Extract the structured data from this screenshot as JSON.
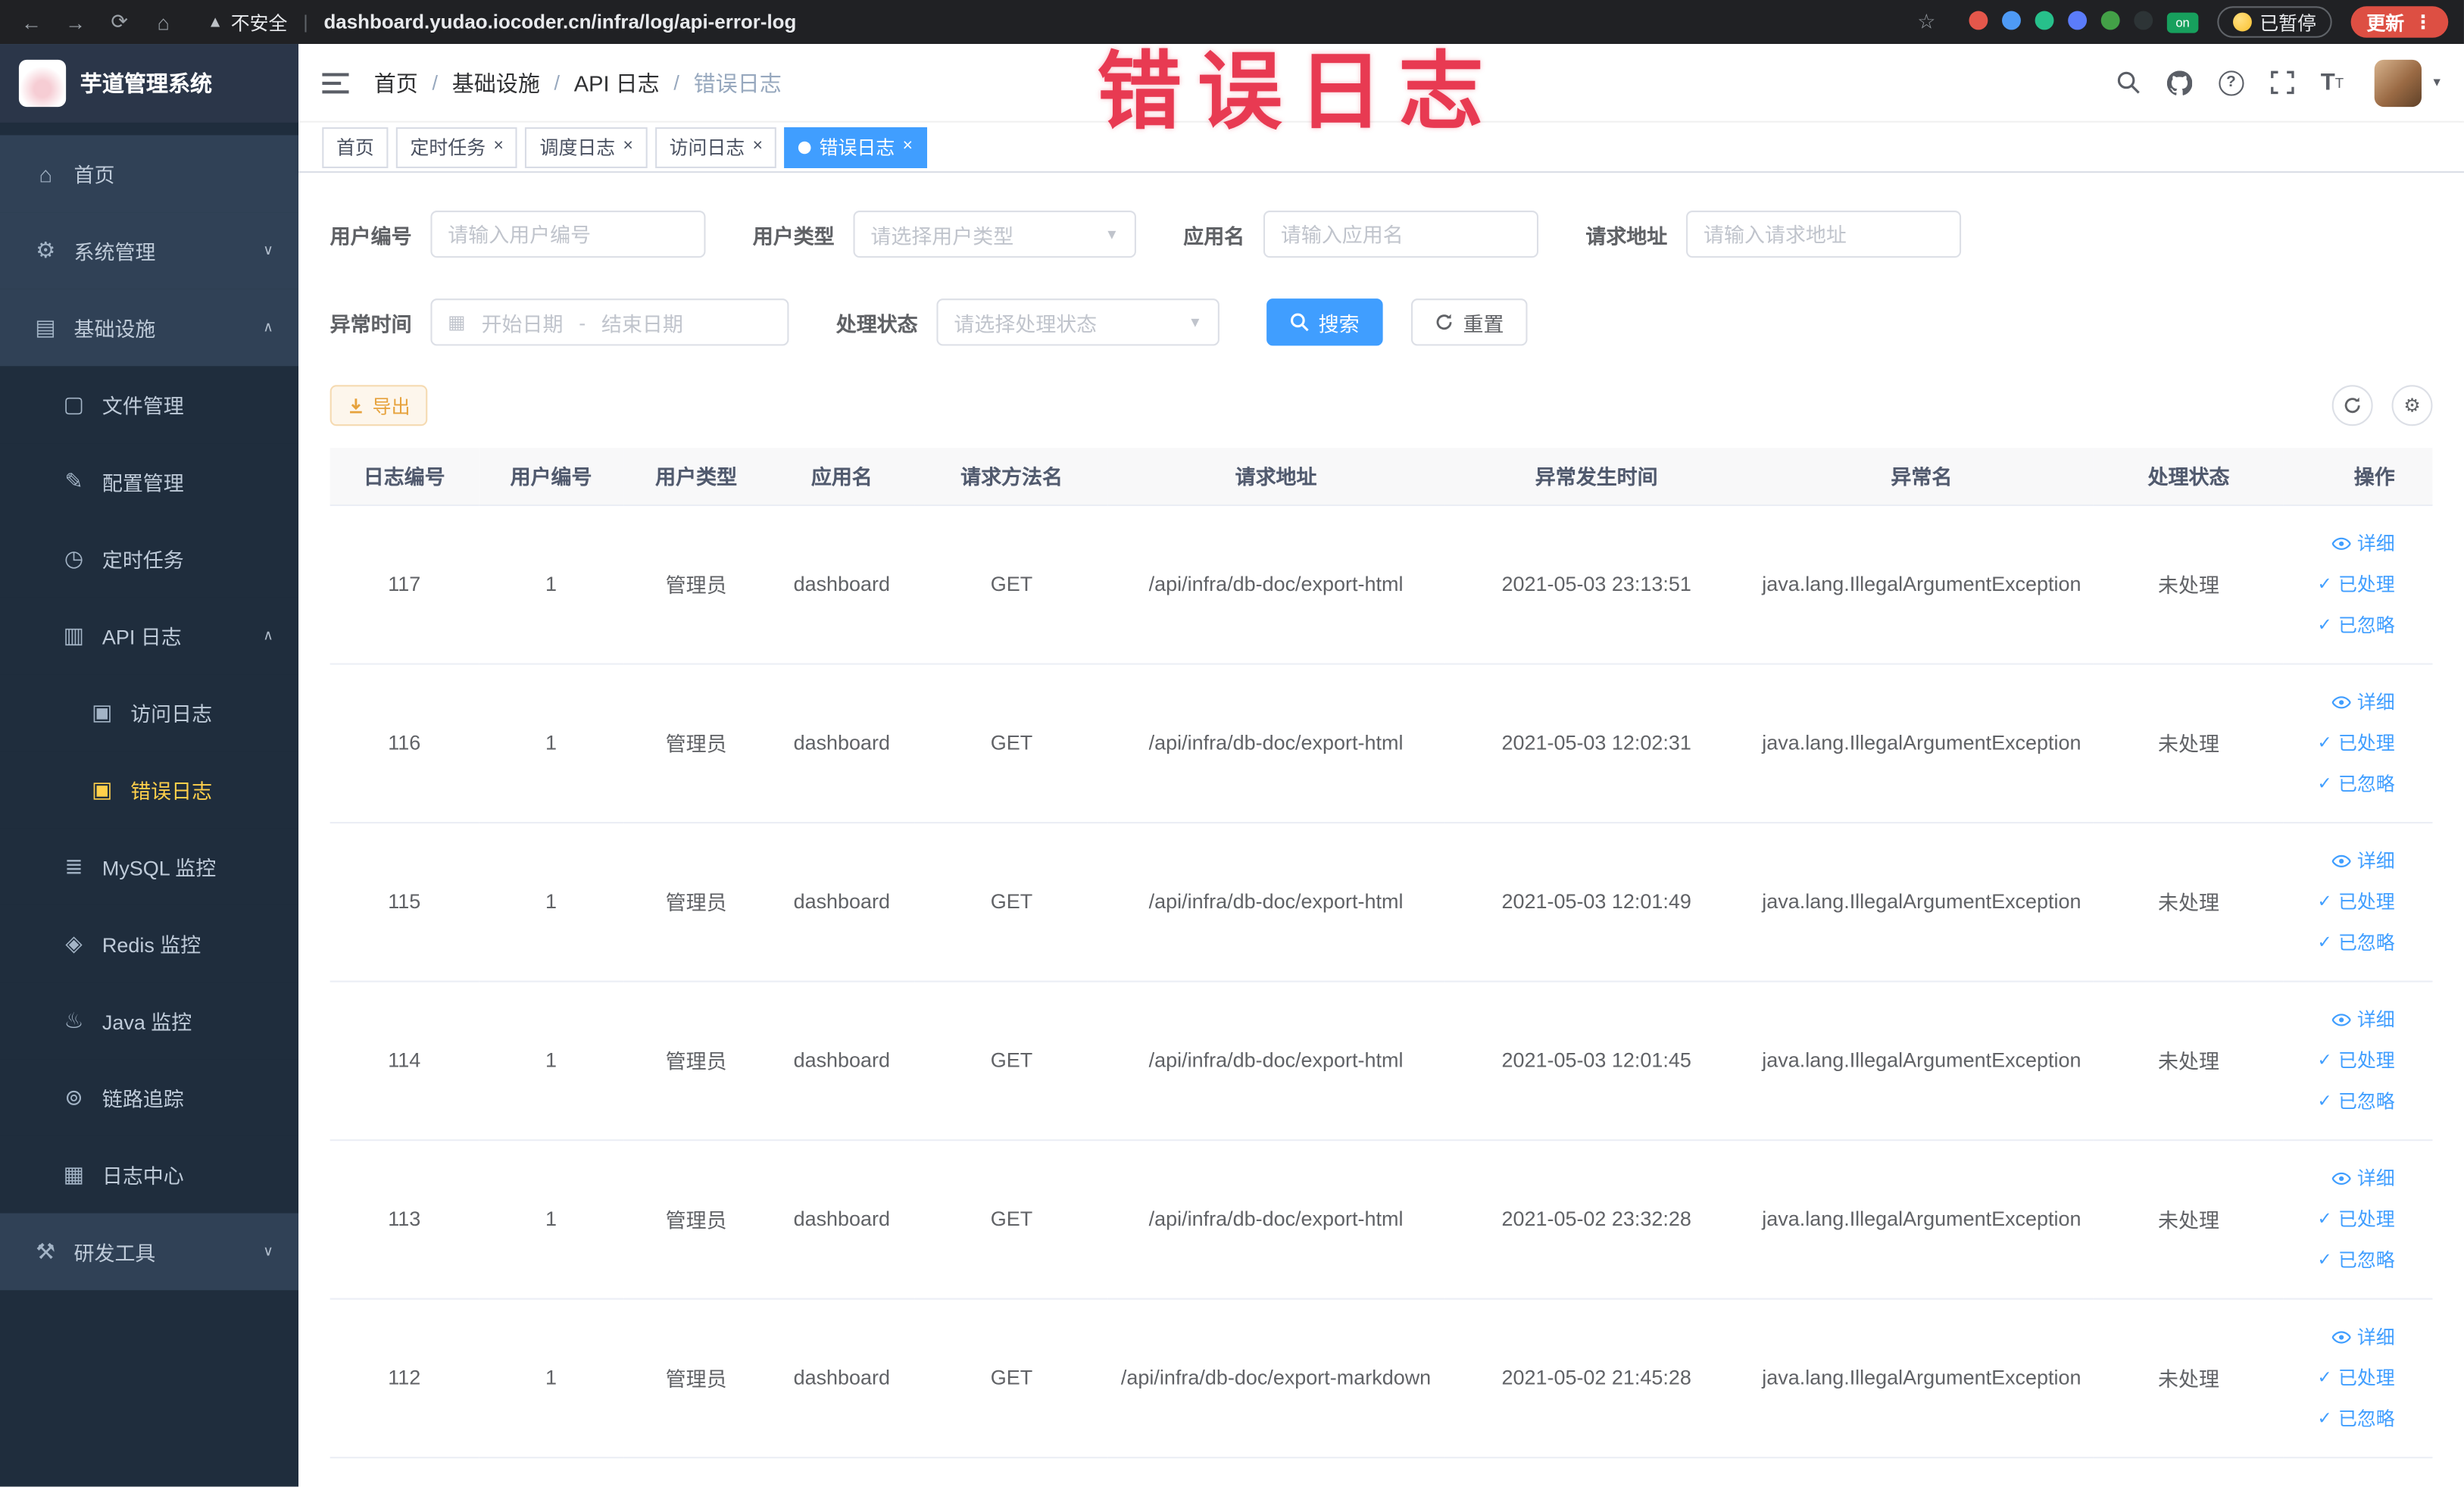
{
  "annotation": {
    "text": "错误日志"
  },
  "browser": {
    "security_text": "不安全",
    "url": "dashboard.yudao.iocoder.cn/infra/log/api-error-log",
    "paused_badge": "已暂停",
    "update_label": "更新",
    "extension_colors": [
      "#e4574b",
      "#4e9af5",
      "#27c08b",
      "#5b7cfa",
      "#43a047",
      "#2d3436"
    ]
  },
  "sidebar": {
    "logo_title": "芋道管理系统",
    "menu": [
      {
        "key": "home",
        "label": "首页",
        "level": 1,
        "icon": "home"
      },
      {
        "key": "system",
        "label": "系统管理",
        "level": 1,
        "icon": "gear",
        "arrow": "down"
      },
      {
        "key": "infra",
        "label": "基础设施",
        "level": 1,
        "icon": "monitor",
        "arrow": "up"
      },
      {
        "key": "file",
        "label": "文件管理",
        "level": 2,
        "icon": "folder"
      },
      {
        "key": "config",
        "label": "配置管理",
        "level": 2,
        "icon": "edit"
      },
      {
        "key": "job",
        "label": "定时任务",
        "level": 2,
        "icon": "timer"
      },
      {
        "key": "api-log",
        "label": "API 日志",
        "level": 2,
        "icon": "log",
        "arrow": "up"
      },
      {
        "key": "access-log",
        "label": "访问日志",
        "level": 3,
        "icon": "doc"
      },
      {
        "key": "error-log",
        "label": "错误日志",
        "level": 3,
        "icon": "doc",
        "active": true
      },
      {
        "key": "mysql",
        "label": "MySQL 监控",
        "level": 2,
        "icon": "database"
      },
      {
        "key": "redis",
        "label": "Redis 监控",
        "level": 2,
        "icon": "redis"
      },
      {
        "key": "java",
        "label": "Java 监控",
        "level": 2,
        "icon": "coffee"
      },
      {
        "key": "trace",
        "label": "链路追踪",
        "level": 2,
        "icon": "trace"
      },
      {
        "key": "log-center",
        "label": "日志中心",
        "level": 2,
        "icon": "chart"
      },
      {
        "key": "dev-tools",
        "label": "研发工具",
        "level": 1,
        "icon": "tools",
        "arrow": "down"
      }
    ]
  },
  "header": {
    "breadcrumb": [
      "首页",
      "基础设施",
      "API 日志",
      "错误日志"
    ]
  },
  "tabs": [
    {
      "label": "首页",
      "closable": false,
      "active": false
    },
    {
      "label": "定时任务",
      "closable": true,
      "active": false
    },
    {
      "label": "调度日志",
      "closable": true,
      "active": false
    },
    {
      "label": "访问日志",
      "closable": true,
      "active": false
    },
    {
      "label": "错误日志",
      "closable": true,
      "active": true
    }
  ],
  "filters": {
    "user_id": {
      "label": "用户编号",
      "placeholder": "请输入用户编号"
    },
    "user_type": {
      "label": "用户类型",
      "placeholder": "请选择用户类型"
    },
    "app_name": {
      "label": "应用名",
      "placeholder": "请输入应用名"
    },
    "request_url": {
      "label": "请求地址",
      "placeholder": "请输入请求地址"
    },
    "exception_time": {
      "label": "异常时间",
      "start_placeholder": "开始日期",
      "separator": "-",
      "end_placeholder": "结束日期"
    },
    "process_status": {
      "label": "处理状态",
      "placeholder": "请选择处理状态"
    },
    "search_label": "搜索",
    "reset_label": "重置"
  },
  "toolbar": {
    "export_label": "导出"
  },
  "table": {
    "columns": [
      "日志编号",
      "用户编号",
      "用户类型",
      "应用名",
      "请求方法名",
      "请求地址",
      "异常发生时间",
      "异常名",
      "处理状态",
      "操作"
    ],
    "action_labels": [
      "详细",
      "已处理",
      "已忽略"
    ],
    "rows": [
      {
        "id": "117",
        "user_id": "1",
        "user_type": "管理员",
        "app": "dashboard",
        "method": "GET",
        "url": "/api/infra/db-doc/export-html",
        "time": "2021-05-03 23:13:51",
        "exception": "java.lang.IllegalArgumentException",
        "status": "未处理"
      },
      {
        "id": "116",
        "user_id": "1",
        "user_type": "管理员",
        "app": "dashboard",
        "method": "GET",
        "url": "/api/infra/db-doc/export-html",
        "time": "2021-05-03 12:02:31",
        "exception": "java.lang.IllegalArgumentException",
        "status": "未处理"
      },
      {
        "id": "115",
        "user_id": "1",
        "user_type": "管理员",
        "app": "dashboard",
        "method": "GET",
        "url": "/api/infra/db-doc/export-html",
        "time": "2021-05-03 12:01:49",
        "exception": "java.lang.IllegalArgumentException",
        "status": "未处理"
      },
      {
        "id": "114",
        "user_id": "1",
        "user_type": "管理员",
        "app": "dashboard",
        "method": "GET",
        "url": "/api/infra/db-doc/export-html",
        "time": "2021-05-03 12:01:45",
        "exception": "java.lang.IllegalArgumentException",
        "status": "未处理"
      },
      {
        "id": "113",
        "user_id": "1",
        "user_type": "管理员",
        "app": "dashboard",
        "method": "GET",
        "url": "/api/infra/db-doc/export-html",
        "time": "2021-05-02 23:32:28",
        "exception": "java.lang.IllegalArgumentException",
        "status": "未处理"
      },
      {
        "id": "112",
        "user_id": "1",
        "user_type": "管理员",
        "app": "dashboard",
        "method": "GET",
        "url": "/api/infra/db-doc/export-markdown",
        "time": "2021-05-02 21:45:28",
        "exception": "java.lang.IllegalArgumentException",
        "status": "未处理"
      }
    ]
  },
  "colors": {
    "accent": "#409eff",
    "sidebar_active": "#ffd04b",
    "warning": "#e6a23c",
    "tag_active": "#409eff",
    "annotation": "#e83a52"
  }
}
